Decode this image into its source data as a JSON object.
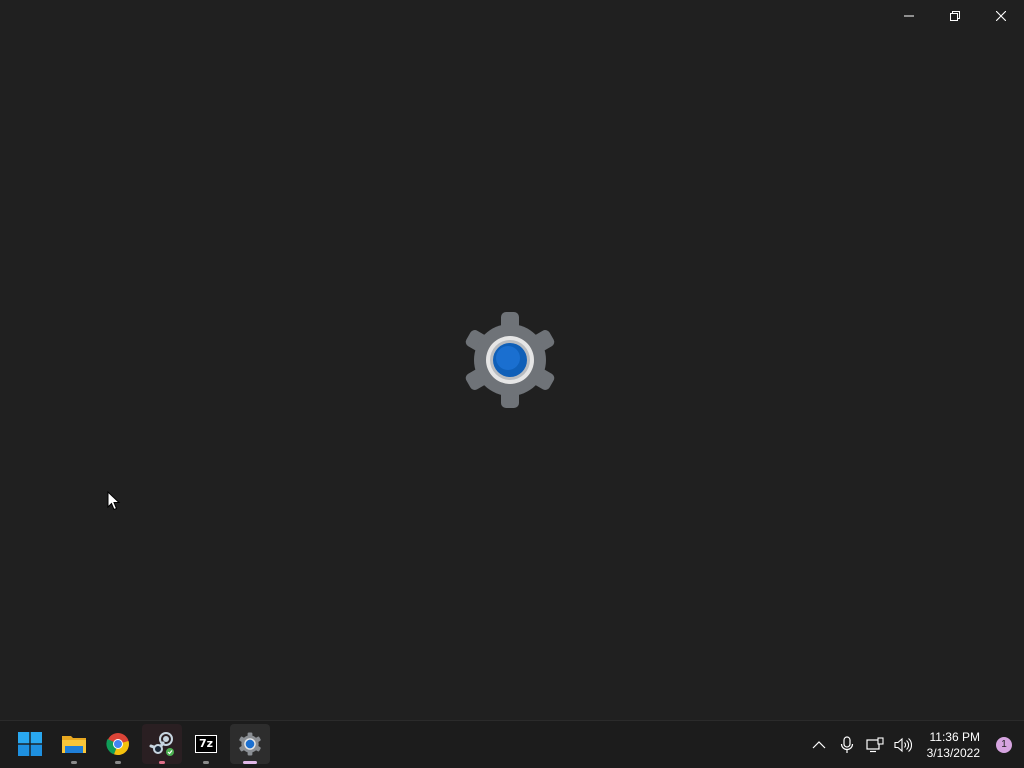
{
  "window": {
    "caption_buttons": [
      "minimize",
      "restore",
      "close"
    ],
    "splash_icon": "settings-gear-icon"
  },
  "taskbar": {
    "apps": [
      {
        "name": "start",
        "icon": "windows-logo-icon"
      },
      {
        "name": "file-explorer",
        "icon": "folder-icon"
      },
      {
        "name": "chrome",
        "icon": "chrome-icon"
      },
      {
        "name": "steam",
        "icon": "steam-icon"
      },
      {
        "name": "7-zip",
        "icon": "7zip-icon",
        "label": "7z"
      },
      {
        "name": "settings",
        "icon": "settings-gear-icon"
      }
    ],
    "tray": {
      "icons": [
        "chevron-up-icon",
        "microphone-icon",
        "network-icon",
        "volume-icon"
      ],
      "time": "11:36 PM",
      "date": "3/13/2022",
      "notification_count": "1"
    }
  },
  "colors": {
    "background": "#202020",
    "taskbar": "#1c1c1c",
    "accent_blue": "#0f5fb8",
    "gear_gray": "#6f7378",
    "notification_badge": "#d6a4e0"
  }
}
